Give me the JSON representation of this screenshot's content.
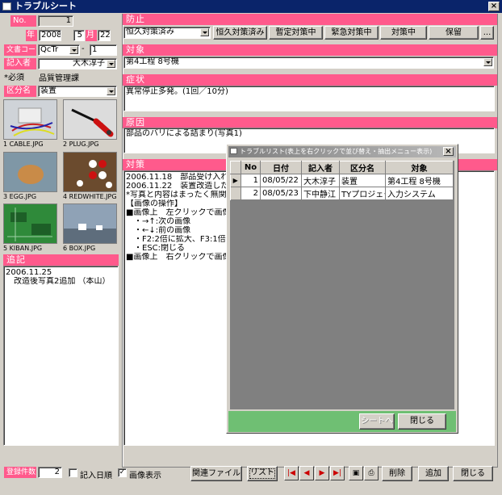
{
  "window": {
    "title": "トラブルシート",
    "close": "×"
  },
  "left": {
    "no_label": "No.",
    "no_value": "1",
    "year_label": "年",
    "year": "2008",
    "month": "5",
    "month_label": "月",
    "day": "22",
    "doc_code_label": "文書コード",
    "doc_code_value": "QcTr",
    "doc_code_sep": "-",
    "doc_code_num": "1",
    "reporter_label": "記入者",
    "reporter_value": "大木淳子",
    "required_note": "*必須",
    "department": "品質管理課",
    "category_label": "区分名",
    "category_value": "装置",
    "thumbnails": [
      {
        "caption": "1 CABLE.JPG",
        "icon": "cable-photo"
      },
      {
        "caption": "2 PLUG.JPG",
        "icon": "plug-photo"
      },
      {
        "caption": "3 EGG.JPG",
        "icon": "egg-photo"
      },
      {
        "caption": "4 REDWHITE.JPG",
        "icon": "redwhite-photo"
      },
      {
        "caption": "5 KIBAN.JPG",
        "icon": "kiban-photo"
      },
      {
        "caption": "6 BOX.JPG",
        "icon": "box-photo"
      }
    ],
    "notes_label": "追記",
    "notes_lines": [
      "2006.11.25",
      "　改造後写真2追加 （本山）"
    ]
  },
  "prevention": {
    "label": "防止",
    "select_value": "恒久対策済み",
    "buttons": [
      "恒久対策済み",
      "暫定対策中",
      "緊急対策中",
      "対策中",
      "保留",
      "..."
    ]
  },
  "target": {
    "label": "対象",
    "value": "第4工程 8号機"
  },
  "symptom": {
    "label": "症状",
    "text": "異常停止多発。(1回／10分)"
  },
  "cause": {
    "label": "原因",
    "text": "部品のバリによる詰まり(写真1)"
  },
  "countermeasure": {
    "label": "対策",
    "lines": [
      "2006.11.18　部品受け入れ検査",
      "2006.11.22　装置改造した結果",
      "",
      "*写真と内容はまったく無関係で",
      "",
      "【画像の操作】",
      "■画像上　左クリックで画像ビ",
      "　・→↑:次の画像",
      "　・←↓:前の画像",
      "　・F2:2倍に拡大、F3:1倍で",
      "　・ESC:閉じる",
      "■画像上　右クリックで画像の"
    ]
  },
  "dialog": {
    "title": "トラブルリスト(表上を右クリックで並び替え・抽出メニュー表示)",
    "close": "×",
    "columns": [
      "No",
      "日付",
      "記入者",
      "区分名",
      "対象"
    ],
    "rows": [
      [
        "1",
        "08/05/22",
        "大木淳子",
        "装置",
        "第4工程 8号機"
      ],
      [
        "2",
        "08/05/23",
        "下中静江",
        "TYプロジェクト",
        "入力システム"
      ]
    ],
    "sheet_button": "シートへ",
    "close_button": "閉じる"
  },
  "footer": {
    "count_label": "登録件数",
    "count_value": "2",
    "entry_date_label": "記入日順",
    "entry_date_checked": false,
    "show_image_label": "画像表示",
    "show_image_checked": true,
    "related_files": "関連ファイル",
    "list": "リスト",
    "delete": "削除",
    "add": "追加",
    "close": "閉じる"
  }
}
